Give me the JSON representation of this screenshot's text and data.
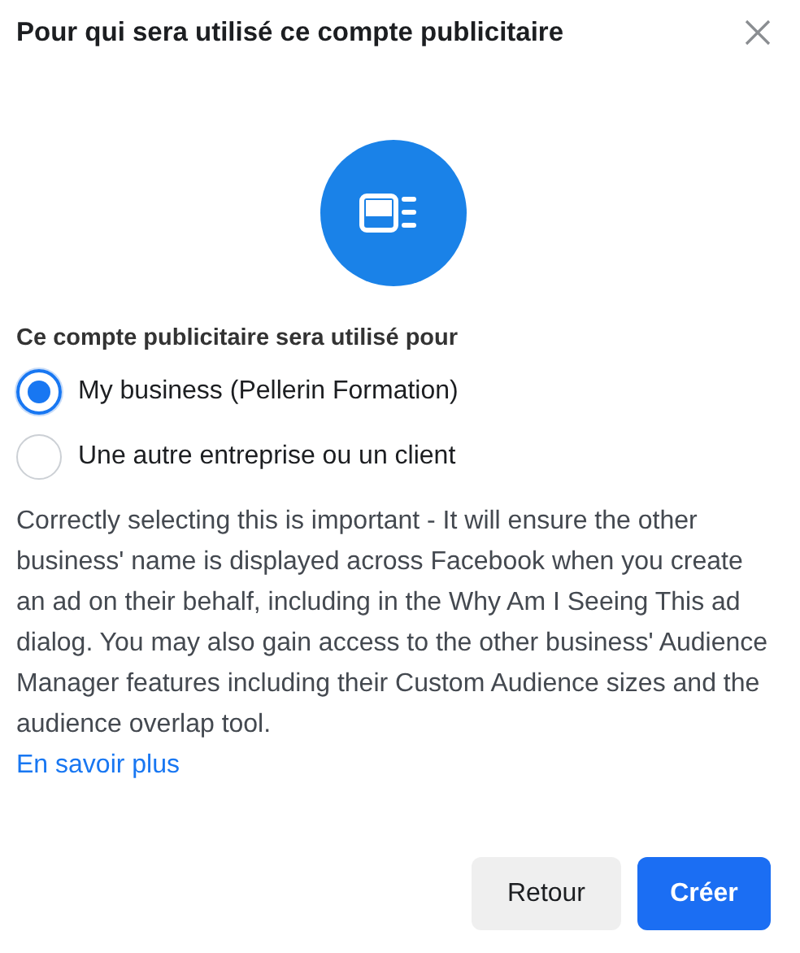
{
  "dialog": {
    "title": "Pour qui sera utilisé ce compte publicitaire"
  },
  "question": "Ce compte publicitaire sera utilisé pour",
  "options": [
    {
      "label": "My business (Pellerin Formation)",
      "selected": true
    },
    {
      "label": "Une autre entreprise ou un client",
      "selected": false
    }
  ],
  "description": "Correctly selecting this is important - It will ensure the other business' name is displayed across Facebook when you create an ad on their behalf, including in the Why Am I Seeing This ad dialog. You may also gain access to the other business' Audience Manager features including their Custom Audience sizes and the audience overlap tool.",
  "learn_more_link": "En savoir plus",
  "buttons": [
    {
      "label": "Retour",
      "kind": "secondary"
    },
    {
      "label": "Créer",
      "kind": "primary"
    }
  ]
}
